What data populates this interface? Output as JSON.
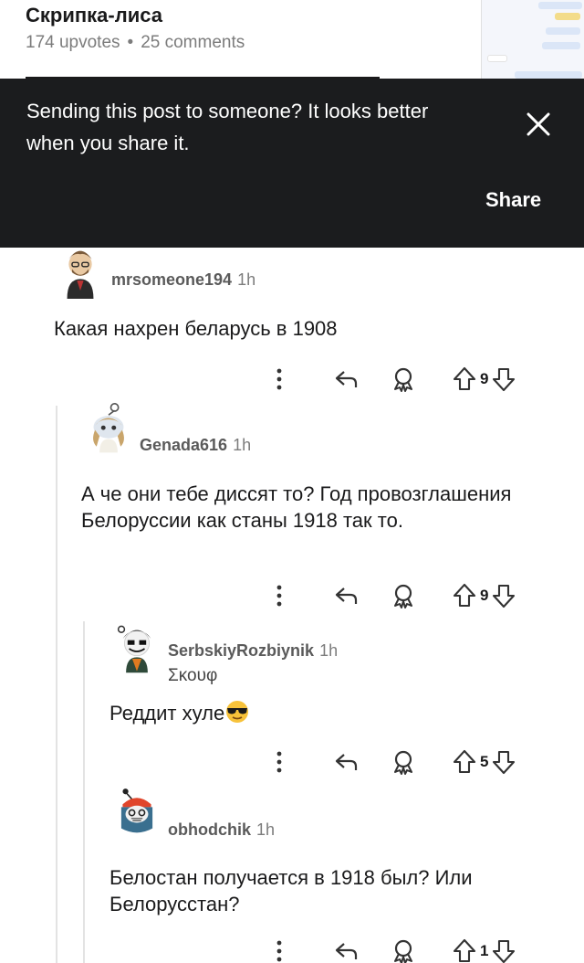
{
  "post": {
    "title": "Скрипка-лиса",
    "upvotes": "174 upvotes",
    "separator": "•",
    "comments": "25 comments",
    "thumbnail_icon": "chat-screenshot-thumbnail"
  },
  "share_banner": {
    "message": "Sending this post to someone? It looks better when you share it.",
    "share_label": "Share",
    "close_icon": "close-icon"
  },
  "comments": [
    {
      "username": "mrsomeone194",
      "time": "1h",
      "body": "Какая нахрен беларусь в 1908",
      "score": "9"
    },
    {
      "username": "Genada616",
      "time": "1h",
      "body": "А че они тебе диссят то? Год провозглашения Белоруссии как станы 1918 так то.",
      "score": "9"
    },
    {
      "username": "SerbskiyRozbiynik",
      "time": "1h",
      "flair": "Σκουφ",
      "body": "Реддит хуле",
      "score": "5"
    },
    {
      "username": "obhodchik",
      "time": "1h",
      "body": "Белостан получается в 1918 был? Или Белорусстан?",
      "score": "1"
    }
  ],
  "icons": {
    "more": "more-vertical-icon",
    "reply": "reply-icon",
    "award": "award-icon",
    "upvote": "upvote-arrow-icon",
    "downvote": "downvote-arrow-icon"
  },
  "colors": {
    "banner_bg": "#1b1c1e",
    "text": "#1a1a1b",
    "meta": "#7c7c7c",
    "thread_line": "#e3e3e3"
  }
}
